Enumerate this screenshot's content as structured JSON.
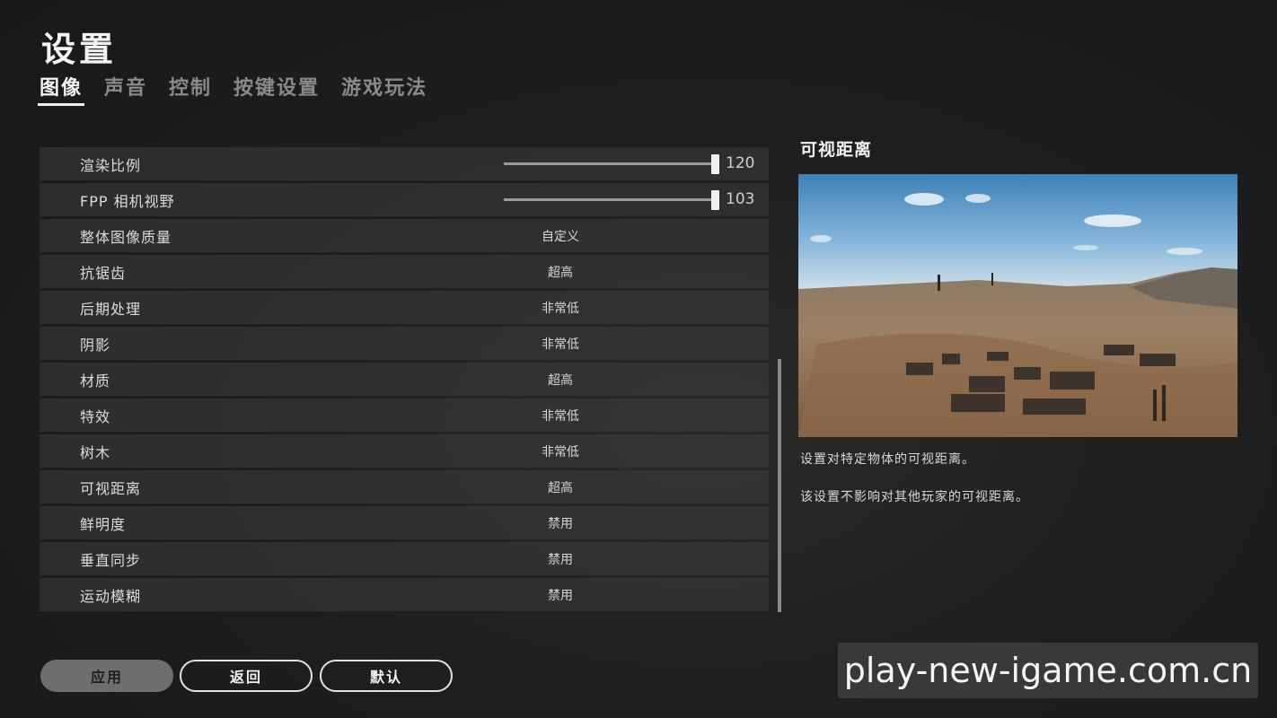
{
  "header": {
    "title": "设置"
  },
  "tabs": [
    {
      "label": "图像",
      "active": true
    },
    {
      "label": "声音",
      "active": false
    },
    {
      "label": "控制",
      "active": false
    },
    {
      "label": "按键设置",
      "active": false
    },
    {
      "label": "游戏玩法",
      "active": false
    }
  ],
  "settings": [
    {
      "label": "渲染比例",
      "type": "slider",
      "value": "120",
      "fill": 1.0
    },
    {
      "label": "FPP 相机视野",
      "type": "slider",
      "value": "103",
      "fill": 1.0
    },
    {
      "label": "整体图像质量",
      "type": "option",
      "value": "自定义"
    },
    {
      "label": "抗锯齿",
      "type": "option",
      "value": "超高"
    },
    {
      "label": "后期处理",
      "type": "option",
      "value": "非常低"
    },
    {
      "label": "阴影",
      "type": "option",
      "value": "非常低"
    },
    {
      "label": "材质",
      "type": "option",
      "value": "超高"
    },
    {
      "label": "特效",
      "type": "option",
      "value": "非常低"
    },
    {
      "label": "树木",
      "type": "option",
      "value": "非常低"
    },
    {
      "label": "可视距离",
      "type": "option",
      "value": "超高"
    },
    {
      "label": "鲜明度",
      "type": "option",
      "value": "禁用"
    },
    {
      "label": "垂直同步",
      "type": "option",
      "value": "禁用"
    },
    {
      "label": "运动模糊",
      "type": "option",
      "value": "禁用"
    }
  ],
  "detail": {
    "title": "可视距离",
    "desc1": "设置对特定物体的可视距离。",
    "desc2": "该设置不影响对其他玩家的可视距离。"
  },
  "buttons": {
    "apply": "应用",
    "back": "返回",
    "default": "默认"
  },
  "watermark": {
    "text": "play-new-igame.com.cn"
  },
  "colors": {
    "background": "#1f1f1f",
    "row": "#3c3c3c",
    "accent": "#f0f0f0"
  }
}
